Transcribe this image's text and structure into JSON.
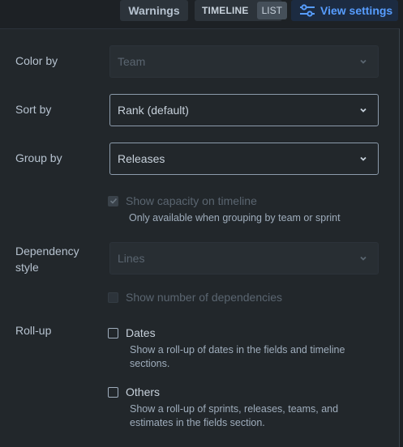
{
  "toolbar": {
    "warnings_label": "Warnings",
    "timeline_label": "TIMELINE",
    "list_label": "LIST",
    "view_settings_label": "View settings",
    "view_settings_icon": "sliders-icon",
    "accent_color": "#579dff"
  },
  "settings": {
    "color_by": {
      "label": "Color by",
      "value": "Team",
      "disabled": true
    },
    "sort_by": {
      "label": "Sort by",
      "value": "Rank (default)",
      "disabled": false
    },
    "group_by": {
      "label": "Group by",
      "value": "Releases",
      "disabled": false
    },
    "show_capacity": {
      "label": "Show capacity on timeline",
      "checked": true,
      "disabled": true,
      "helper": "Only available when grouping by team or sprint"
    },
    "dependency_style": {
      "label": "Dependency style",
      "value": "Lines",
      "disabled": true
    },
    "show_dependencies": {
      "label": "Show number of dependencies",
      "checked": false,
      "disabled": true
    },
    "rollup": {
      "label": "Roll-up",
      "dates": {
        "label": "Dates",
        "checked": false,
        "helper_line1": "Show a roll-up of dates in the fields and timeline",
        "helper_line2": "sections."
      },
      "others": {
        "label": "Others",
        "checked": false,
        "helper_line1": "Show a roll-up of sprints, releases, teams, and",
        "helper_line2": "estimates in the fields section."
      }
    }
  }
}
